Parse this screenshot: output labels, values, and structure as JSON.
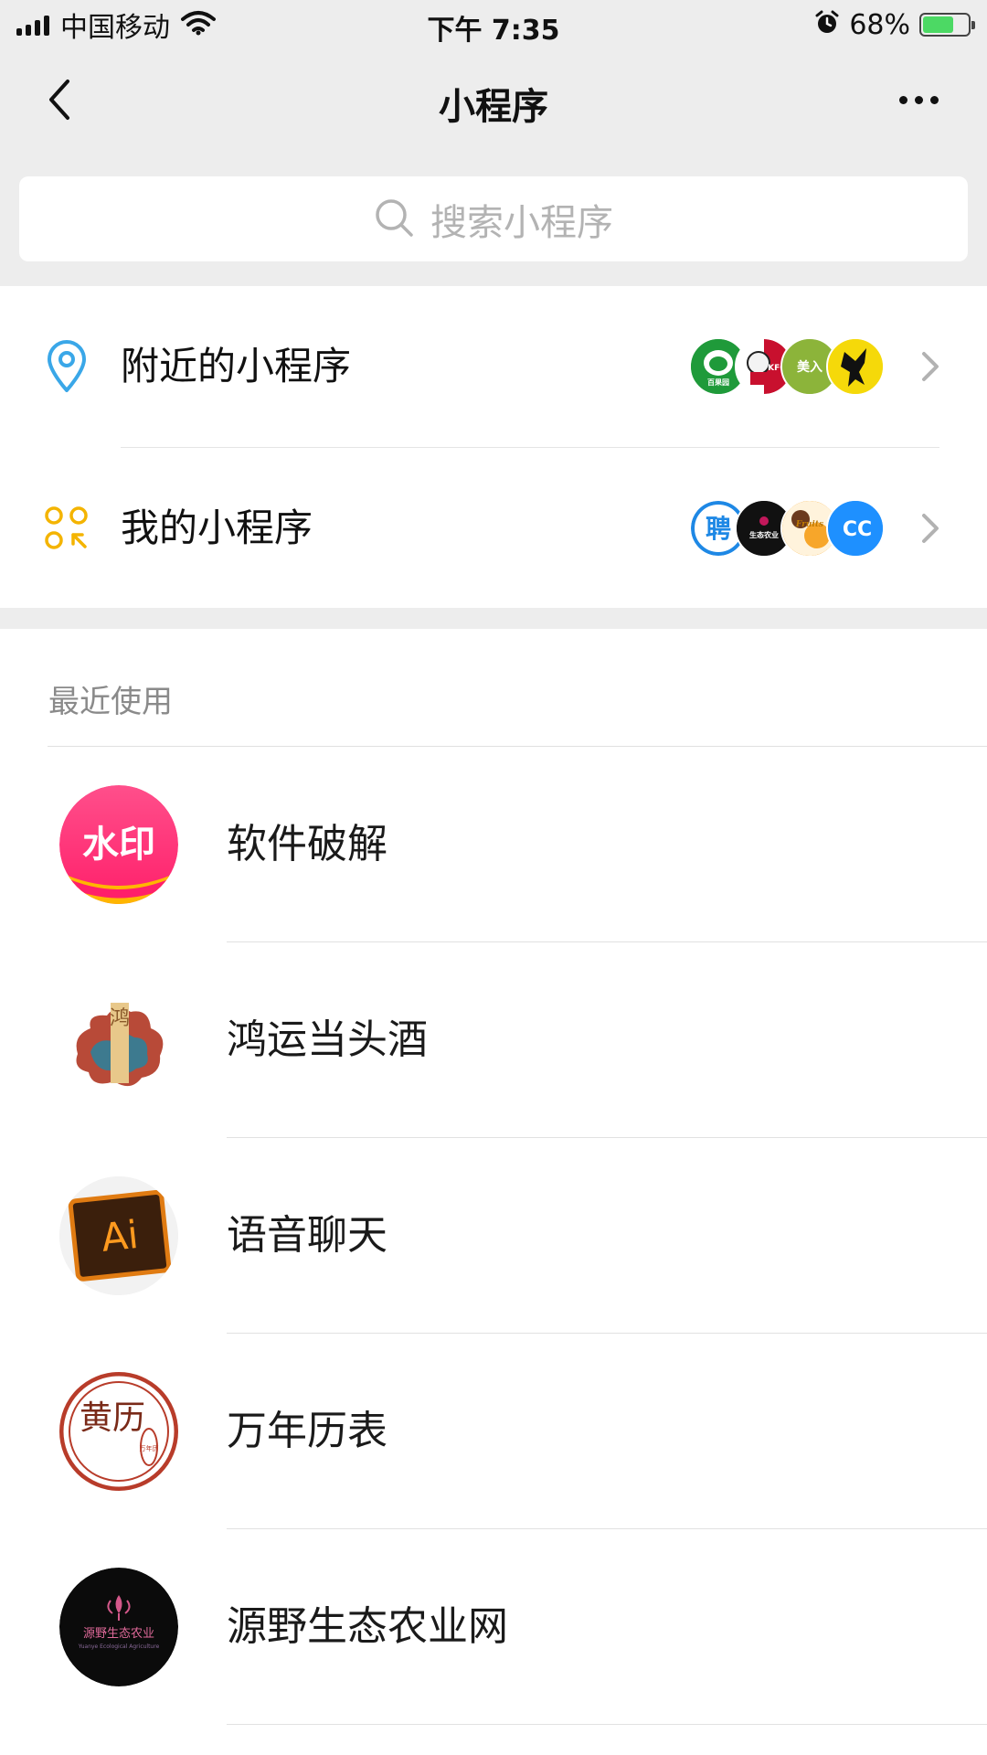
{
  "status_bar": {
    "carrier": "中国移动",
    "time": "下午 7:35",
    "battery_percent": "68%",
    "battery_level": 0.68,
    "icons": [
      "signal-icon",
      "wifi-icon",
      "alarm-icon",
      "battery-icon"
    ]
  },
  "nav": {
    "title": "小程序",
    "back_icon": "chevron-left-icon",
    "more_icon": "more-icon"
  },
  "search": {
    "placeholder": "搜索小程序",
    "icon": "search-icon"
  },
  "entries": {
    "nearby": {
      "label": "附近的小程序",
      "icon": "location-pin-icon",
      "avatars": [
        "百果园",
        "KFC",
        "美入",
        "figure"
      ]
    },
    "mine": {
      "label": "我的小程序",
      "icon": "grid-icon",
      "avatars": [
        "聘",
        "生态农业",
        "Fruits",
        "CC"
      ]
    }
  },
  "recent": {
    "header": "最近使用",
    "apps": [
      {
        "name": "软件破解",
        "icon_text": "水印"
      },
      {
        "name": "鸿运当头酒",
        "icon_text": "鸿"
      },
      {
        "name": "语音聊天",
        "icon_text": "Ai"
      },
      {
        "name": "万年历表",
        "icon_text": "黄历",
        "icon_subtext": "万年历"
      },
      {
        "name": "源野生态农业网",
        "icon_text": "源野生态农业",
        "icon_subtext": "Yuanye Ecological Agriculture"
      }
    ]
  },
  "colors": {
    "background": "#ededed",
    "accent_blue": "#3aa7e8",
    "accent_yellow": "#f4b400",
    "battery_green": "#4cd964"
  }
}
